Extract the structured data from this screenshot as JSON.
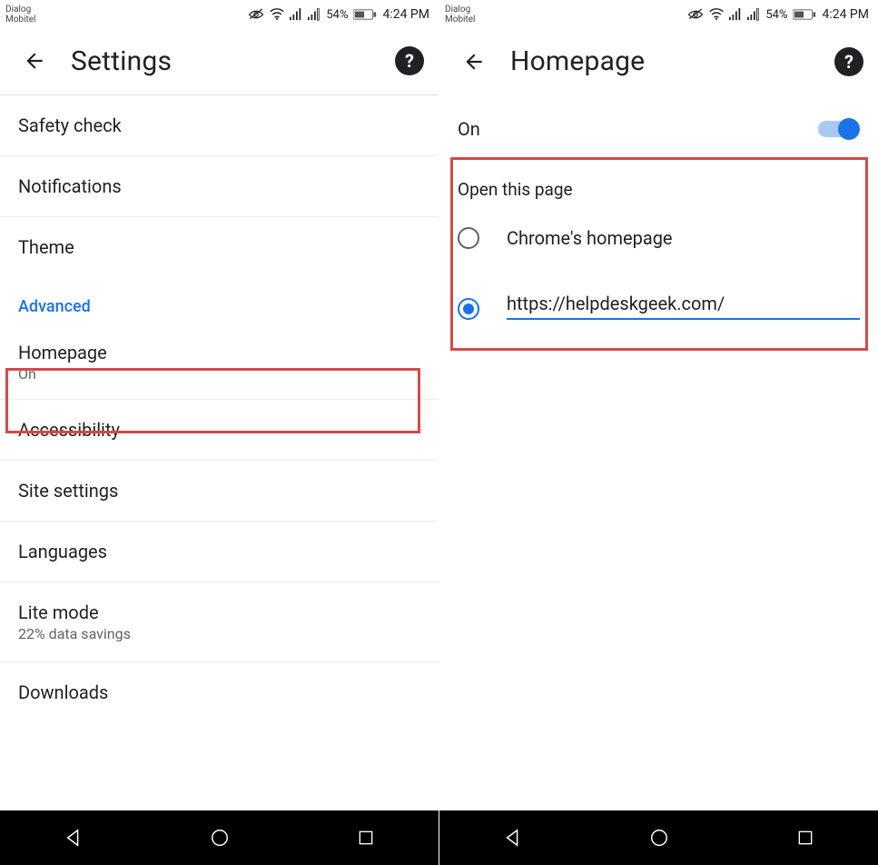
{
  "status": {
    "carrier_line1": "Dialog",
    "carrier_line2": "Mobitel",
    "battery_pct": "54%",
    "time": "4:24 PM"
  },
  "left": {
    "title": "Settings",
    "items": {
      "safety_check": "Safety check",
      "notifications": "Notifications",
      "theme": "Theme",
      "section_advanced": "Advanced",
      "homepage": "Homepage",
      "homepage_sub": "On",
      "accessibility": "Accessibility",
      "site_settings": "Site settings",
      "languages": "Languages",
      "lite_mode": "Lite mode",
      "lite_mode_sub": "22% data savings",
      "downloads": "Downloads"
    }
  },
  "right": {
    "title": "Homepage",
    "toggle_label": "On",
    "section_label": "Open this page",
    "option_chrome": "Chrome's homepage",
    "url_value": "https://helpdeskgeek.com/"
  }
}
